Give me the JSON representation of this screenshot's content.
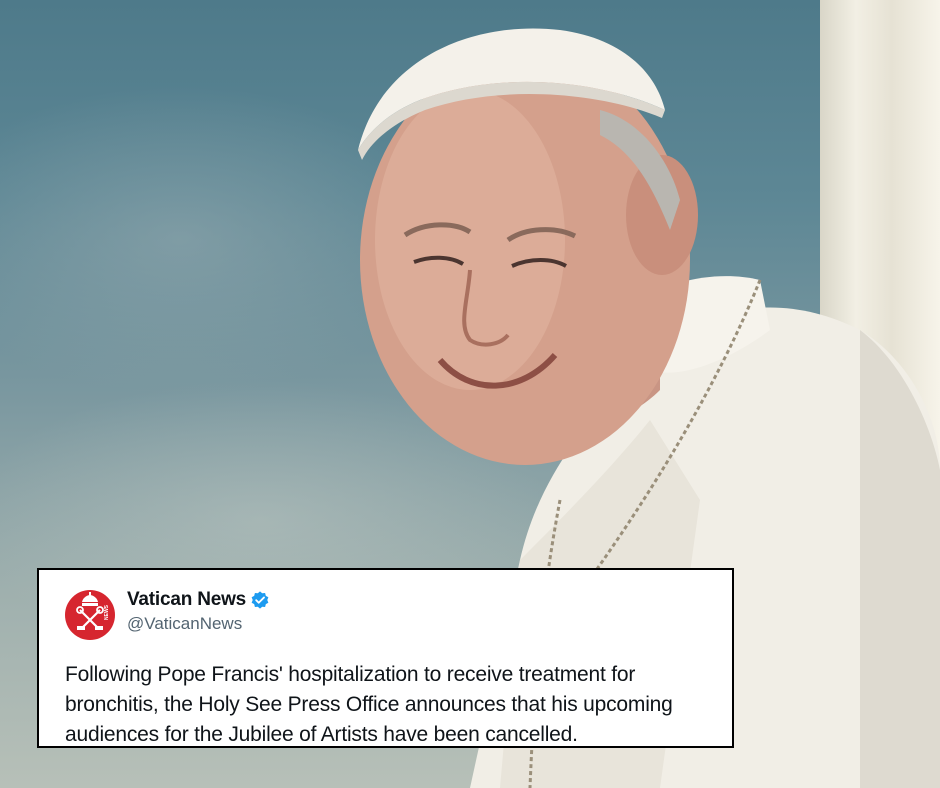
{
  "tweet": {
    "display_name": "Vatican News",
    "handle": "@VaticanNews",
    "verified_icon": "verified-badge-icon",
    "avatar_text": "NEWS",
    "text": "Following Pope Francis' hospitalization to receive treatment for bronchitis, the Holy See Press Office announces that his upcoming audiences for the Jubilee of Artists have been cancelled."
  },
  "colors": {
    "avatar_red": "#d6262f",
    "verified_blue": "#1d9bf0",
    "text_dark": "#0f1419",
    "handle_gray": "#536471"
  }
}
